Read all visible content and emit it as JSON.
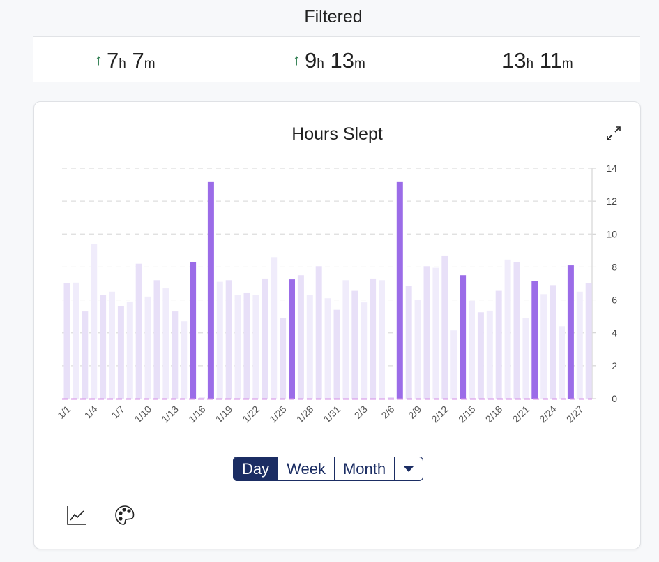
{
  "header": {
    "title": "Filtered"
  },
  "stats": [
    {
      "hours": "7",
      "h_unit": "h",
      "minutes": "7",
      "m_unit": "m",
      "trend": "up"
    },
    {
      "hours": "9",
      "h_unit": "h",
      "minutes": "13",
      "m_unit": "m",
      "trend": "up"
    },
    {
      "hours": "13",
      "h_unit": "h",
      "minutes": "11",
      "m_unit": "m",
      "trend": "none"
    }
  ],
  "colors": {
    "highlight": "#9b6ce8",
    "light_a": "#e8e0f8",
    "light_b": "#f0ecfb",
    "trend_up": "#2e7d4f",
    "nav": "#1b2d63"
  },
  "chart_data": {
    "type": "bar",
    "title": "Hours Slept",
    "ylim": [
      0,
      14
    ],
    "yticks": [
      0,
      2,
      4,
      6,
      8,
      10,
      12,
      14
    ],
    "y_axis_position": "right",
    "grid": true,
    "categories": [
      "1/1",
      "1/2",
      "1/3",
      "1/4",
      "1/5",
      "1/6",
      "1/7",
      "1/8",
      "1/9",
      "1/10",
      "1/11",
      "1/12",
      "1/13",
      "1/14",
      "1/15",
      "1/16",
      "1/17",
      "1/18",
      "1/19",
      "1/20",
      "1/21",
      "1/22",
      "1/23",
      "1/24",
      "1/25",
      "1/26",
      "1/27",
      "1/28",
      "1/29",
      "1/30",
      "1/31",
      "2/1",
      "2/2",
      "2/3",
      "2/4",
      "2/5",
      "2/6",
      "2/7",
      "2/8",
      "2/9",
      "2/10",
      "2/11",
      "2/12",
      "2/13",
      "2/14",
      "2/15",
      "2/16",
      "2/17",
      "2/18",
      "2/19",
      "2/20",
      "2/21",
      "2/22",
      "2/23",
      "2/24",
      "2/25",
      "2/26",
      "2/27",
      "2/28"
    ],
    "values": [
      7.0,
      7.05,
      5.3,
      9.4,
      6.3,
      6.5,
      5.6,
      5.9,
      8.2,
      6.2,
      7.2,
      6.7,
      5.3,
      4.7,
      8.3,
      0.1,
      13.2,
      7.1,
      7.2,
      6.3,
      6.45,
      6.3,
      7.3,
      8.6,
      4.9,
      7.25,
      7.5,
      6.3,
      8.05,
      6.1,
      5.4,
      7.2,
      6.55,
      5.85,
      7.3,
      7.2,
      0.1,
      13.2,
      6.85,
      6.0,
      8.05,
      7.95,
      8.7,
      4.15,
      7.5,
      5.95,
      5.25,
      5.35,
      6.55,
      8.45,
      8.3,
      4.9,
      7.15,
      6.35,
      6.9,
      4.4,
      8.1,
      6.5,
      7.0
    ],
    "highlighted": [
      "1/15",
      "1/17",
      "1/26",
      "2/7",
      "2/14",
      "2/22",
      "2/26"
    ],
    "xtick_labels": [
      "1/1",
      "1/4",
      "1/7",
      "1/10",
      "1/13",
      "1/16",
      "1/19",
      "1/22",
      "1/25",
      "1/28",
      "1/31",
      "2/3",
      "2/6",
      "2/9",
      "2/12",
      "2/15",
      "2/18",
      "2/21",
      "2/24",
      "2/27"
    ]
  },
  "controls": {
    "periods": [
      "Day",
      "Week",
      "Month"
    ],
    "selected": "Day"
  }
}
